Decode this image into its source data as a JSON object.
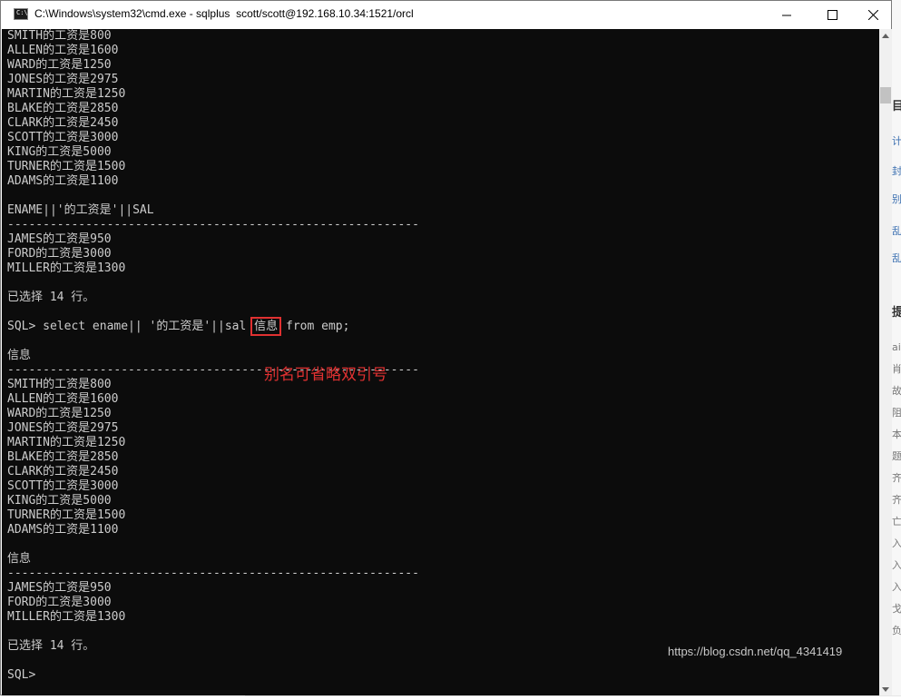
{
  "window": {
    "title": "C:\\Windows\\system32\\cmd.exe - sqlplus  scott/scott@192.168.10.34:1521/orcl",
    "icon_label": "C:\\"
  },
  "console": {
    "block1": [
      "SMITH的工资是800",
      "ALLEN的工资是1600",
      "WARD的工资是1250",
      "JONES的工资是2975",
      "MARTIN的工资是1250",
      "BLAKE的工资是2850",
      "CLARK的工资是2450",
      "SCOTT的工资是3000",
      "KING的工资是5000",
      "TURNER的工资是1500",
      "ADAMS的工资是1100"
    ],
    "header1": "ENAME||'的工资是'||SAL",
    "separator": "----------------------------------------------------------",
    "block2": [
      "JAMES的工资是950",
      "FORD的工资是3000",
      "MILLER的工资是1300"
    ],
    "rows_selected": "已选择 14 行。",
    "command": {
      "prefix": "SQL> select ename|| '的工资是'||sal ",
      "highlight": "信息",
      "suffix": " from emp;"
    },
    "header2": "信息",
    "block3": [
      "SMITH的工资是800",
      "ALLEN的工资是1600",
      "WARD的工资是1250",
      "JONES的工资是2975",
      "MARTIN的工资是1250",
      "BLAKE的工资是2850",
      "CLARK的工资是2450",
      "SCOTT的工资是3000",
      "KING的工资是5000",
      "TURNER的工资是1500",
      "ADAMS的工资是1100"
    ],
    "header3": "信息",
    "block4": [
      "JAMES的工资是950",
      "FORD的工资是3000",
      "MILLER的工资是1300"
    ],
    "rows_selected_2": "已选择 14 行。",
    "prompt": "SQL>"
  },
  "annotation": "别名可省略双引号",
  "watermark": "https://blog.csdn.net/qq_4341419",
  "background_fragments": [
    "目",
    "计",
    "封",
    "别",
    "乱",
    "乱",
    "提",
    "ai",
    "肖",
    "故",
    "阻",
    "本",
    "题",
    "齐",
    "齐",
    "亡",
    "入",
    "入",
    "入",
    "戈",
    "负"
  ],
  "colors": {
    "console_bg": "#0c0c0c",
    "console_text": "#cccccc",
    "annotation_red": "#e03131"
  }
}
